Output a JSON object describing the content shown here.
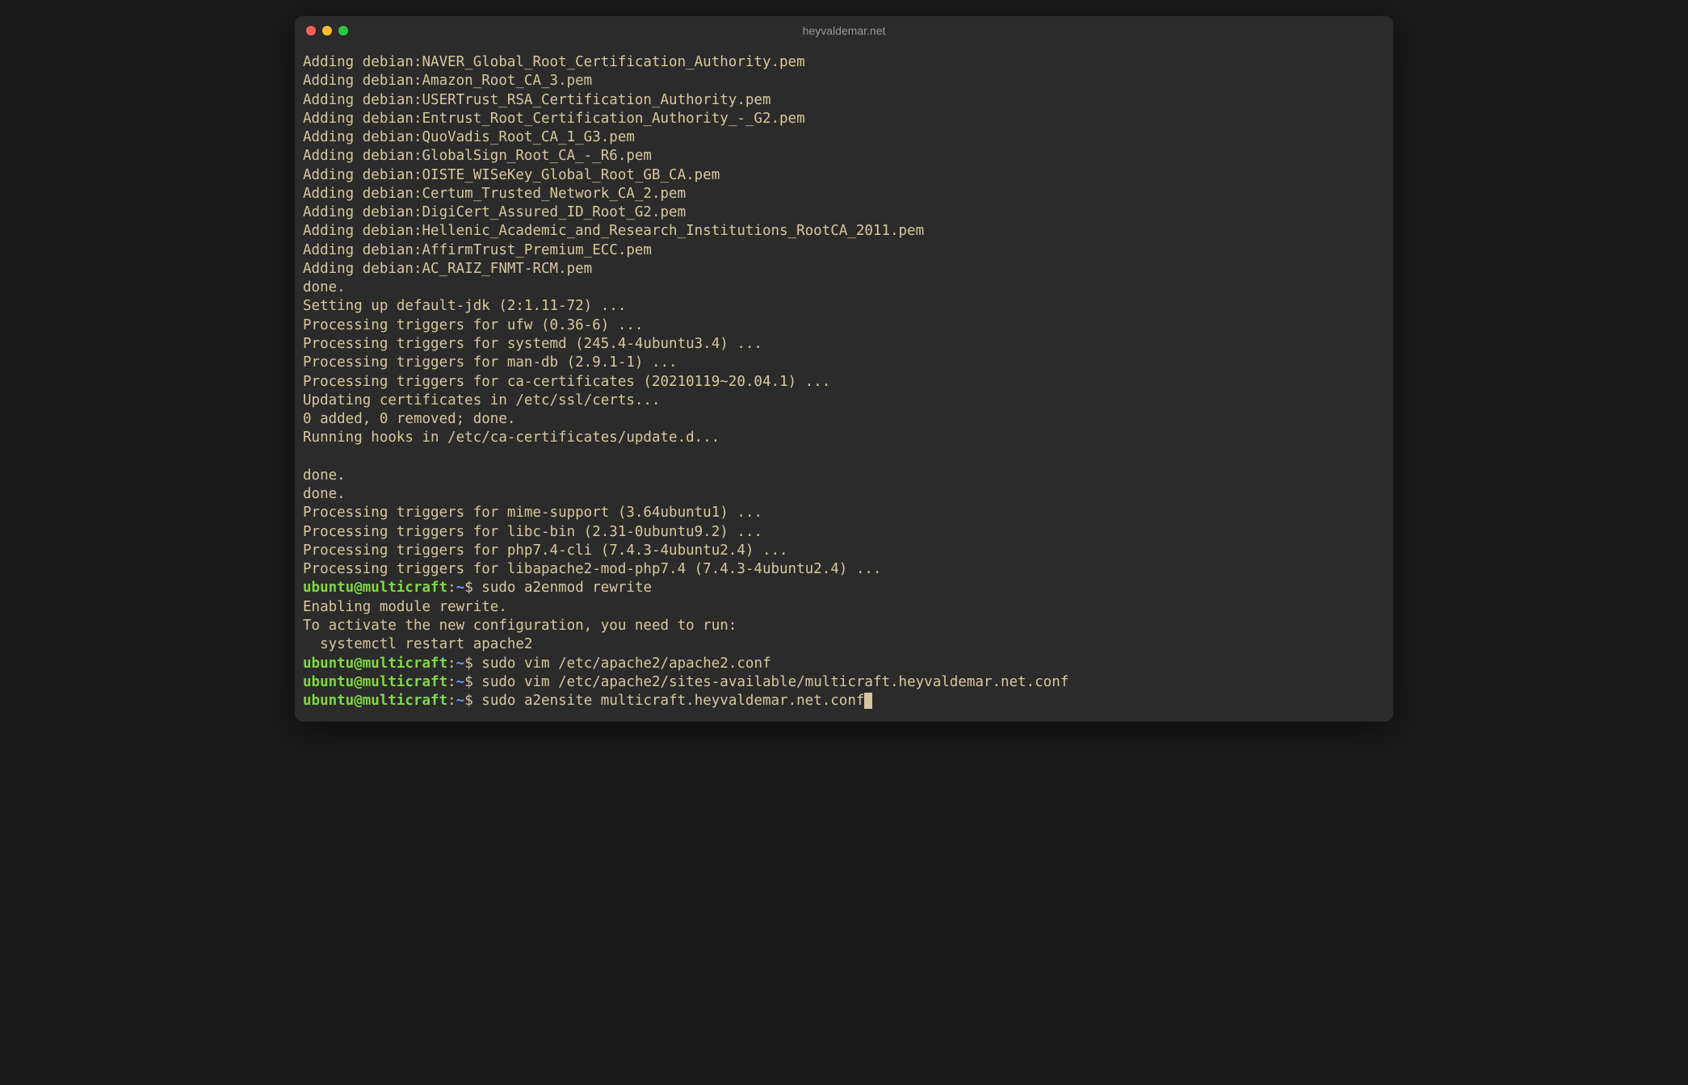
{
  "window": {
    "title": "heyvaldemar.net"
  },
  "output_lines": [
    "Adding debian:NAVER_Global_Root_Certification_Authority.pem",
    "Adding debian:Amazon_Root_CA_3.pem",
    "Adding debian:USERTrust_RSA_Certification_Authority.pem",
    "Adding debian:Entrust_Root_Certification_Authority_-_G2.pem",
    "Adding debian:QuoVadis_Root_CA_1_G3.pem",
    "Adding debian:GlobalSign_Root_CA_-_R6.pem",
    "Adding debian:OISTE_WISeKey_Global_Root_GB_CA.pem",
    "Adding debian:Certum_Trusted_Network_CA_2.pem",
    "Adding debian:DigiCert_Assured_ID_Root_G2.pem",
    "Adding debian:Hellenic_Academic_and_Research_Institutions_RootCA_2011.pem",
    "Adding debian:AffirmTrust_Premium_ECC.pem",
    "Adding debian:AC_RAIZ_FNMT-RCM.pem",
    "done.",
    "Setting up default-jdk (2:1.11-72) ...",
    "Processing triggers for ufw (0.36-6) ...",
    "Processing triggers for systemd (245.4-4ubuntu3.4) ...",
    "Processing triggers for man-db (2.9.1-1) ...",
    "Processing triggers for ca-certificates (20210119~20.04.1) ...",
    "Updating certificates in /etc/ssl/certs...",
    "0 added, 0 removed; done.",
    "Running hooks in /etc/ca-certificates/update.d...",
    "",
    "done.",
    "done.",
    "Processing triggers for mime-support (3.64ubuntu1) ...",
    "Processing triggers for libc-bin (2.31-0ubuntu9.2) ...",
    "Processing triggers for php7.4-cli (7.4.3-4ubuntu2.4) ...",
    "Processing triggers for libapache2-mod-php7.4 (7.4.3-4ubuntu2.4) ..."
  ],
  "prompts": [
    {
      "user_host": "ubuntu@multicraft",
      "path": "~",
      "command": "sudo a2enmod rewrite",
      "output": [
        "Enabling module rewrite.",
        "To activate the new configuration, you need to run:",
        "  systemctl restart apache2"
      ]
    },
    {
      "user_host": "ubuntu@multicraft",
      "path": "~",
      "command": "sudo vim /etc/apache2/apache2.conf",
      "output": []
    },
    {
      "user_host": "ubuntu@multicraft",
      "path": "~",
      "command": "sudo vim /etc/apache2/sites-available/multicraft.heyvaldemar.net.conf",
      "output": []
    },
    {
      "user_host": "ubuntu@multicraft",
      "path": "~",
      "command": "sudo a2ensite multicraft.heyvaldemar.net.conf",
      "output": [],
      "cursor": true
    }
  ]
}
